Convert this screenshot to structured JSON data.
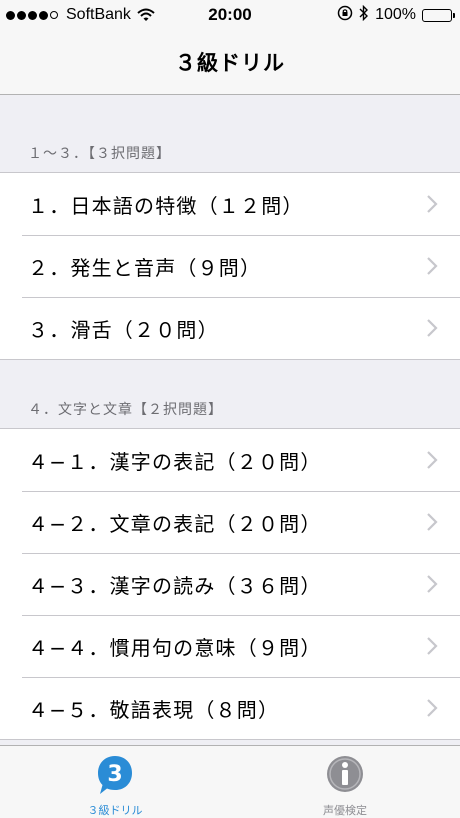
{
  "status_bar": {
    "carrier": "SoftBank",
    "time": "20:00",
    "battery": "100%",
    "battery_level": 1.0,
    "signal_bars": 5,
    "icons": [
      "signal-dots-icon",
      "wifi-icon",
      "rotation-lock-icon",
      "bluetooth-icon",
      "battery-icon"
    ]
  },
  "nav": {
    "title": "３級ドリル"
  },
  "sections": [
    {
      "header": "１〜３．【３択問題】",
      "items": [
        {
          "label": "１．日本語の特徴（１２問）"
        },
        {
          "label": "２．発生と音声（９問）"
        },
        {
          "label": "３．滑舌（２０問）"
        }
      ]
    },
    {
      "header": "４．文字と文章【２択問題】",
      "items": [
        {
          "label": "４−１．漢字の表記（２０問）"
        },
        {
          "label": "４−２．文章の表記（２０問）"
        },
        {
          "label": "４−３．漢字の読み（３６問）"
        },
        {
          "label": "４−４．慣用句の意味（９問）"
        },
        {
          "label": "４−５．敬語表現（８問）"
        }
      ]
    }
  ],
  "tabbar": {
    "tabs": [
      {
        "label": "３級ドリル",
        "icon": "drill-3-icon",
        "active": true
      },
      {
        "label": "声優検定",
        "icon": "info-icon",
        "active": false
      }
    ],
    "colors": {
      "active": "#2a8cd6",
      "inactive": "#8e8e93"
    }
  }
}
